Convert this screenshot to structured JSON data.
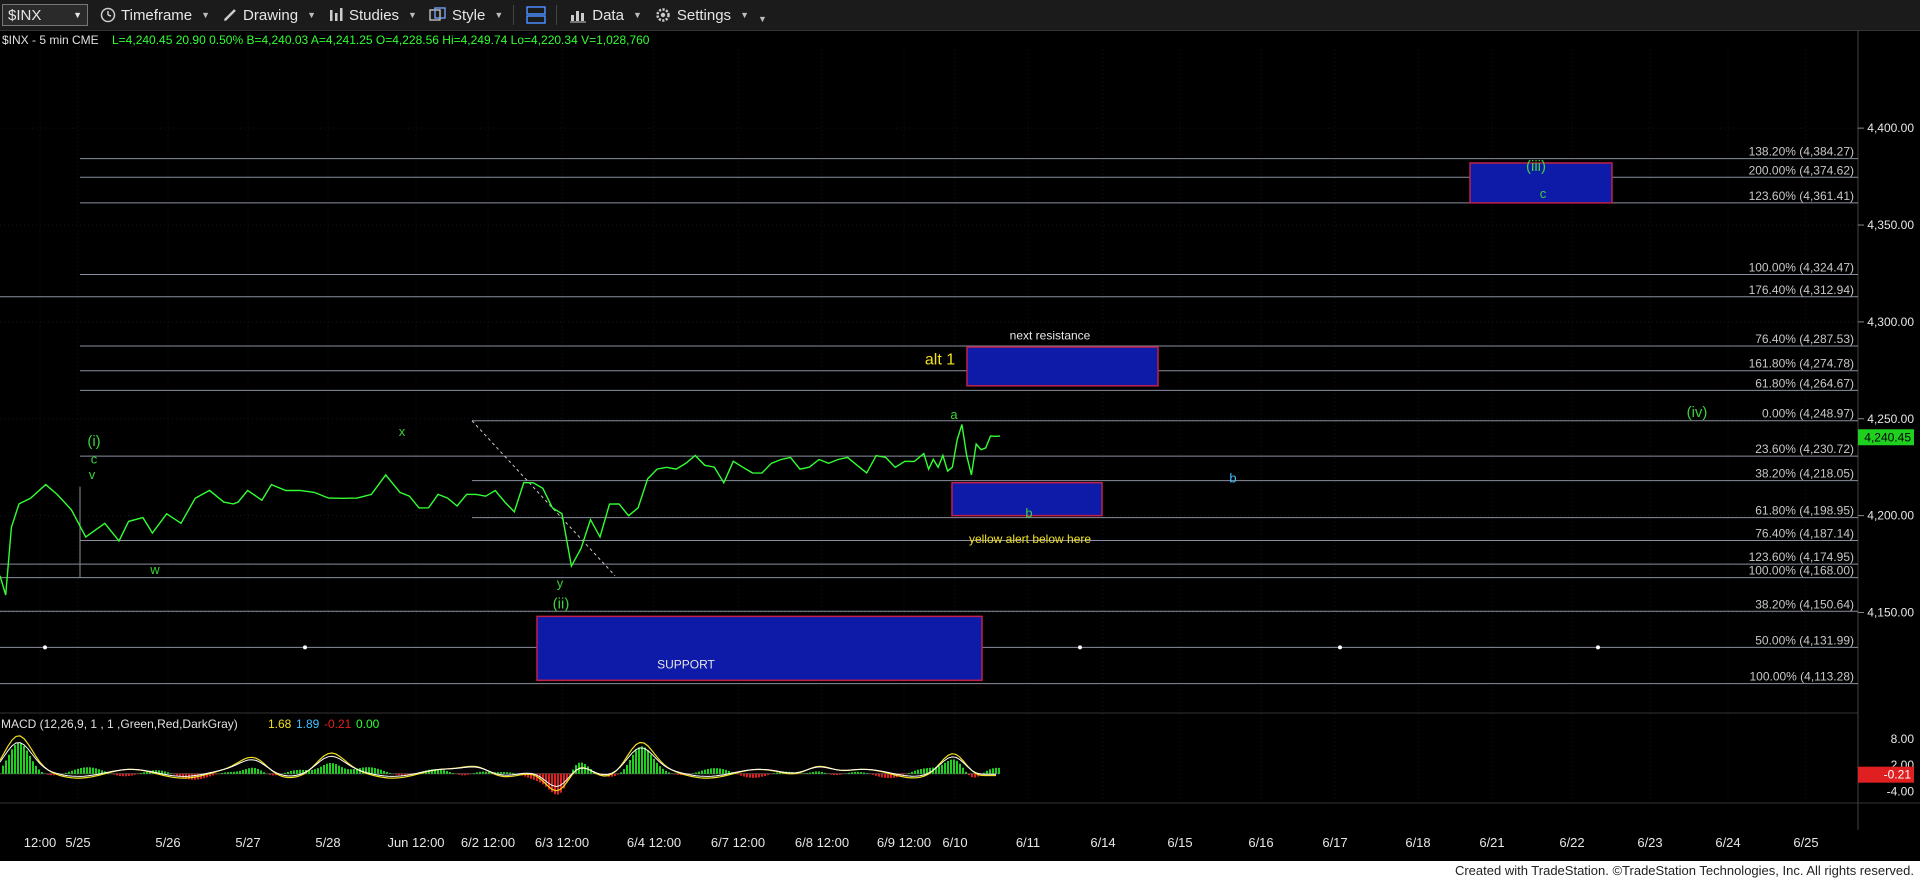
{
  "toolbar": {
    "symbol": "$INX",
    "timeframe": "Timeframe",
    "drawing": "Drawing",
    "studies": "Studies",
    "style": "Style",
    "data": "Data",
    "settings": "Settings"
  },
  "header": {
    "symbol_desc": "$INX - 5 min  CME",
    "quote": "L=4,240.45  20.90  0.50%  B=4,240.03  A=4,241.25  O=4,228.56  Hi=4,249.74  Lo=4,220.34  V=1,028,760"
  },
  "macd_header": {
    "label": "MACD (12,26,9, 1 , 1 ,Green,Red,DarkGray)",
    "v1": "1.68",
    "v2": "1.89",
    "v3": "-0.21",
    "v4": "0.00"
  },
  "footer": "Created with TradeStation. ©TradeStation Technologies, Inc. All rights reserved.",
  "colors": {
    "price": "#32ff32",
    "fib_line": "#8a8fa0",
    "box_fill": "#0e1aa8",
    "box_border": "#c0204a",
    "wave_label": "#3cd23c",
    "annot_yellow": "#f0e020",
    "macd_up": "#1fd01f",
    "macd_down": "#e02020"
  },
  "chart_data": {
    "type": "line",
    "title": "$INX - 5 min",
    "y_axis": {
      "ylim": [
        4110,
        4430
      ],
      "ticks": [
        4150,
        4200,
        4250,
        4300,
        4350,
        4400
      ],
      "tick_labels": [
        "4,150.00",
        "4,200.00",
        "4,250.00",
        "4,300.00",
        "4,350.00",
        "4,400.00"
      ]
    },
    "x_ticks": [
      "12:00",
      "5/25",
      "5/26",
      "5/27",
      "5/28",
      "Jun 12:00",
      "6/2 12:00",
      "6/3 12:00",
      "6/4 12:00",
      "6/7 12:00",
      "6/8 12:00",
      "6/9 12:00",
      "6/10",
      "6/11",
      "6/14",
      "6/15",
      "6/16",
      "6/17",
      "6/18",
      "6/21",
      "6/22",
      "6/23",
      "6/24",
      "6/25"
    ],
    "last_price_label": "4,240.45",
    "series": [
      {
        "x": [
          0,
          6,
          12,
          20,
          32,
          48,
          60,
          75,
          90,
          110,
          125,
          135,
          150,
          160,
          175,
          190,
          205,
          220,
          235,
          245,
          250,
          260,
          275,
          285,
          300,
          315,
          330,
          345,
          360,
          375,
          390,
          405,
          420,
          430,
          440,
          450,
          460,
          470,
          480,
          490,
          500,
          510,
          520,
          530,
          540,
          550,
          560,
          570,
          580,
          590,
          600,
          610,
          620,
          630,
          640,
          650,
          660,
          670,
          680,
          690,
          700,
          710,
          720,
          730,
          740,
          750,
          760,
          770,
          780,
          790,
          800,
          810,
          820,
          830,
          840,
          850,
          860,
          870,
          880,
          890,
          900,
          910,
          920,
          930,
          940,
          950,
          960,
          970,
          975,
          980,
          985,
          990,
          995,
          1000,
          1005,
          1010,
          1015,
          1020,
          1025,
          1030,
          1035,
          1040,
          1045,
          1050
        ],
        "y": [
          4170,
          4158,
          4195,
          4205,
          4210,
          4215,
          4212,
          4202,
          4190,
          4195,
          4188,
          4196,
          4200,
          4190,
          4202,
          4195,
          4210,
          4212,
          4208,
          4205,
          4208,
          4212,
          4209,
          4215,
          4214,
          4212,
          4213,
          4208,
          4210,
          4208,
          4212,
          4220,
          4213,
          4209,
          4205,
          4203,
          4212,
          4208,
          4206,
          4210,
          4212,
          4209,
          4214,
          4206,
          4203,
          4216,
          4218,
          4213,
          4205,
          4200,
          4175,
          4182,
          4199,
          4188,
          4207,
          4205,
          4201,
          4203,
          4220,
          4223,
          4226,
          4223,
          4228,
          4230,
          4227,
          4224,
          4218,
          4227,
          4226,
          4221,
          4223,
          4226,
          4230,
          4229,
          4225,
          4224,
          4230,
          4226,
          4230,
          4229,
          4227,
          4221,
          4232,
          4229,
          4226,
          4227,
          4229,
          4231,
          4225,
          4228,
          4226,
          4230,
          4224,
          4224,
          4240,
          4246,
          4232,
          4220,
          4238,
          4233,
          4236,
          4240,
          4242,
          4240
        ]
      }
    ],
    "fib_levels": [
      {
        "pct": "138.20%",
        "value": 4384.27
      },
      {
        "pct": "200.00%",
        "value": 4374.62
      },
      {
        "pct": "123.60%",
        "value": 4361.41
      },
      {
        "pct": "100.00%",
        "value": 4324.47
      },
      {
        "pct": "176.40%",
        "value": 4312.94
      },
      {
        "pct": "76.40%",
        "value": 4287.53
      },
      {
        "pct": "161.80%",
        "value": 4274.78
      },
      {
        "pct": "61.80%",
        "value": 4264.67
      },
      {
        "pct": "0.00%",
        "value": 4248.97
      },
      {
        "pct": "23.60%",
        "value": 4230.72
      },
      {
        "pct": "38.20%",
        "value": 4218.05
      },
      {
        "pct": "61.80%",
        "value": 4198.95
      },
      {
        "pct": "76.40%",
        "value": 4187.14
      },
      {
        "pct": "123.60%",
        "value": 4174.95
      },
      {
        "pct": "100.00%",
        "value": 4168.0
      },
      {
        "pct": "38.20%",
        "value": 4150.64
      },
      {
        "pct": "50.00%",
        "value": 4131.99
      },
      {
        "pct": "100.00%",
        "value": 4113.28
      }
    ],
    "annotations": [
      {
        "text": "(iii)",
        "kind": "wave"
      },
      {
        "text": "c",
        "kind": "wave"
      },
      {
        "text": "next resistance",
        "kind": "note"
      },
      {
        "text": "alt 1",
        "kind": "yellow"
      },
      {
        "text": "(iv)",
        "kind": "wave"
      },
      {
        "text": "a",
        "kind": "wave"
      },
      {
        "text": "b",
        "kind": "wave"
      },
      {
        "text": "b",
        "kind": "wave"
      },
      {
        "text": "yellow alert below here",
        "kind": "yellow"
      },
      {
        "text": "(i)",
        "kind": "wave"
      },
      {
        "text": "c",
        "kind": "wave"
      },
      {
        "text": "v",
        "kind": "wave"
      },
      {
        "text": "x",
        "kind": "wave"
      },
      {
        "text": "w",
        "kind": "wave"
      },
      {
        "text": "y",
        "kind": "wave"
      },
      {
        "text": "(ii)",
        "kind": "wave"
      },
      {
        "text": "SUPPORT",
        "kind": "note"
      }
    ],
    "macd": {
      "ylim": [
        -6,
        10
      ],
      "ticks": [
        8,
        2,
        -4
      ],
      "tick_labels": [
        "8.00",
        "2.00",
        "-4.00"
      ],
      "last_label": "-0.21"
    }
  }
}
